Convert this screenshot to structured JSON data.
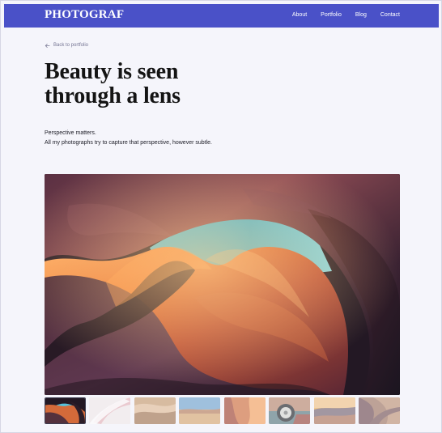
{
  "header": {
    "brand": "PHOTOGRAF",
    "nav": [
      "About",
      "Portfolio",
      "Blog",
      "Contact"
    ],
    "background": "#4a51c8"
  },
  "back_link": {
    "label": "Back to portfolio",
    "icon": "arrow-left-icon"
  },
  "hero": {
    "title_lines": [
      "Beauty is seen",
      "through a lens"
    ],
    "intro_lines": [
      "Perspective matters.",
      "All my photographs try to capture that perspective, however subtle."
    ]
  },
  "gallery": {
    "thumbnails": [
      {
        "name": "canyon-arch",
        "active": true
      },
      {
        "name": "pink-paper",
        "active": false
      },
      {
        "name": "sand-dunes",
        "active": false
      },
      {
        "name": "desert-sky",
        "active": false
      },
      {
        "name": "orange-canyon",
        "active": false
      },
      {
        "name": "vintage-car-wheel",
        "active": false
      },
      {
        "name": "sunset-desert",
        "active": false
      },
      {
        "name": "rock-wave",
        "active": false
      }
    ]
  }
}
